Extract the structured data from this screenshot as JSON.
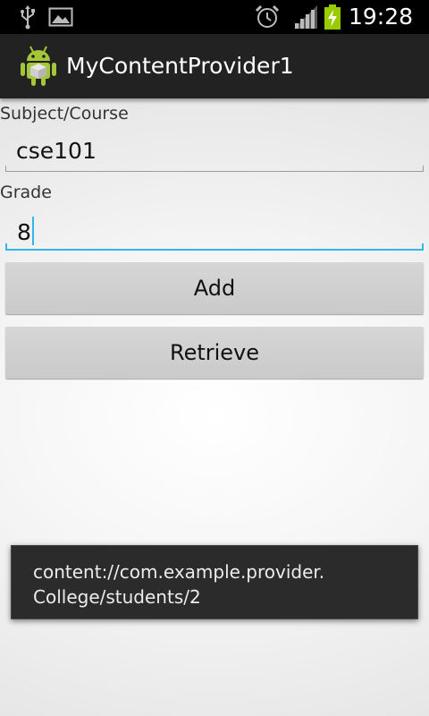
{
  "status_bar": {
    "time": "19:28",
    "icons": [
      "usb-icon",
      "gallery-icon",
      "alarm-icon",
      "signal-icon",
      "battery-charging-icon"
    ]
  },
  "action_bar": {
    "app_icon": "android-app-icon",
    "title": "MyContentProvider1"
  },
  "form": {
    "subject_label": "Subject/Course",
    "subject_value": "cse101",
    "grade_label": "Grade",
    "grade_value": "8"
  },
  "buttons": {
    "add_label": "Add",
    "retrieve_label": "Retrieve"
  },
  "toast": {
    "line1": "content://com.example.provider.",
    "line2": "College/students/2"
  },
  "colors": {
    "accent": "#33b5e5",
    "battery": "#99cc00",
    "action_bar": "#222222",
    "toast_bg": "#2b2b2b"
  }
}
